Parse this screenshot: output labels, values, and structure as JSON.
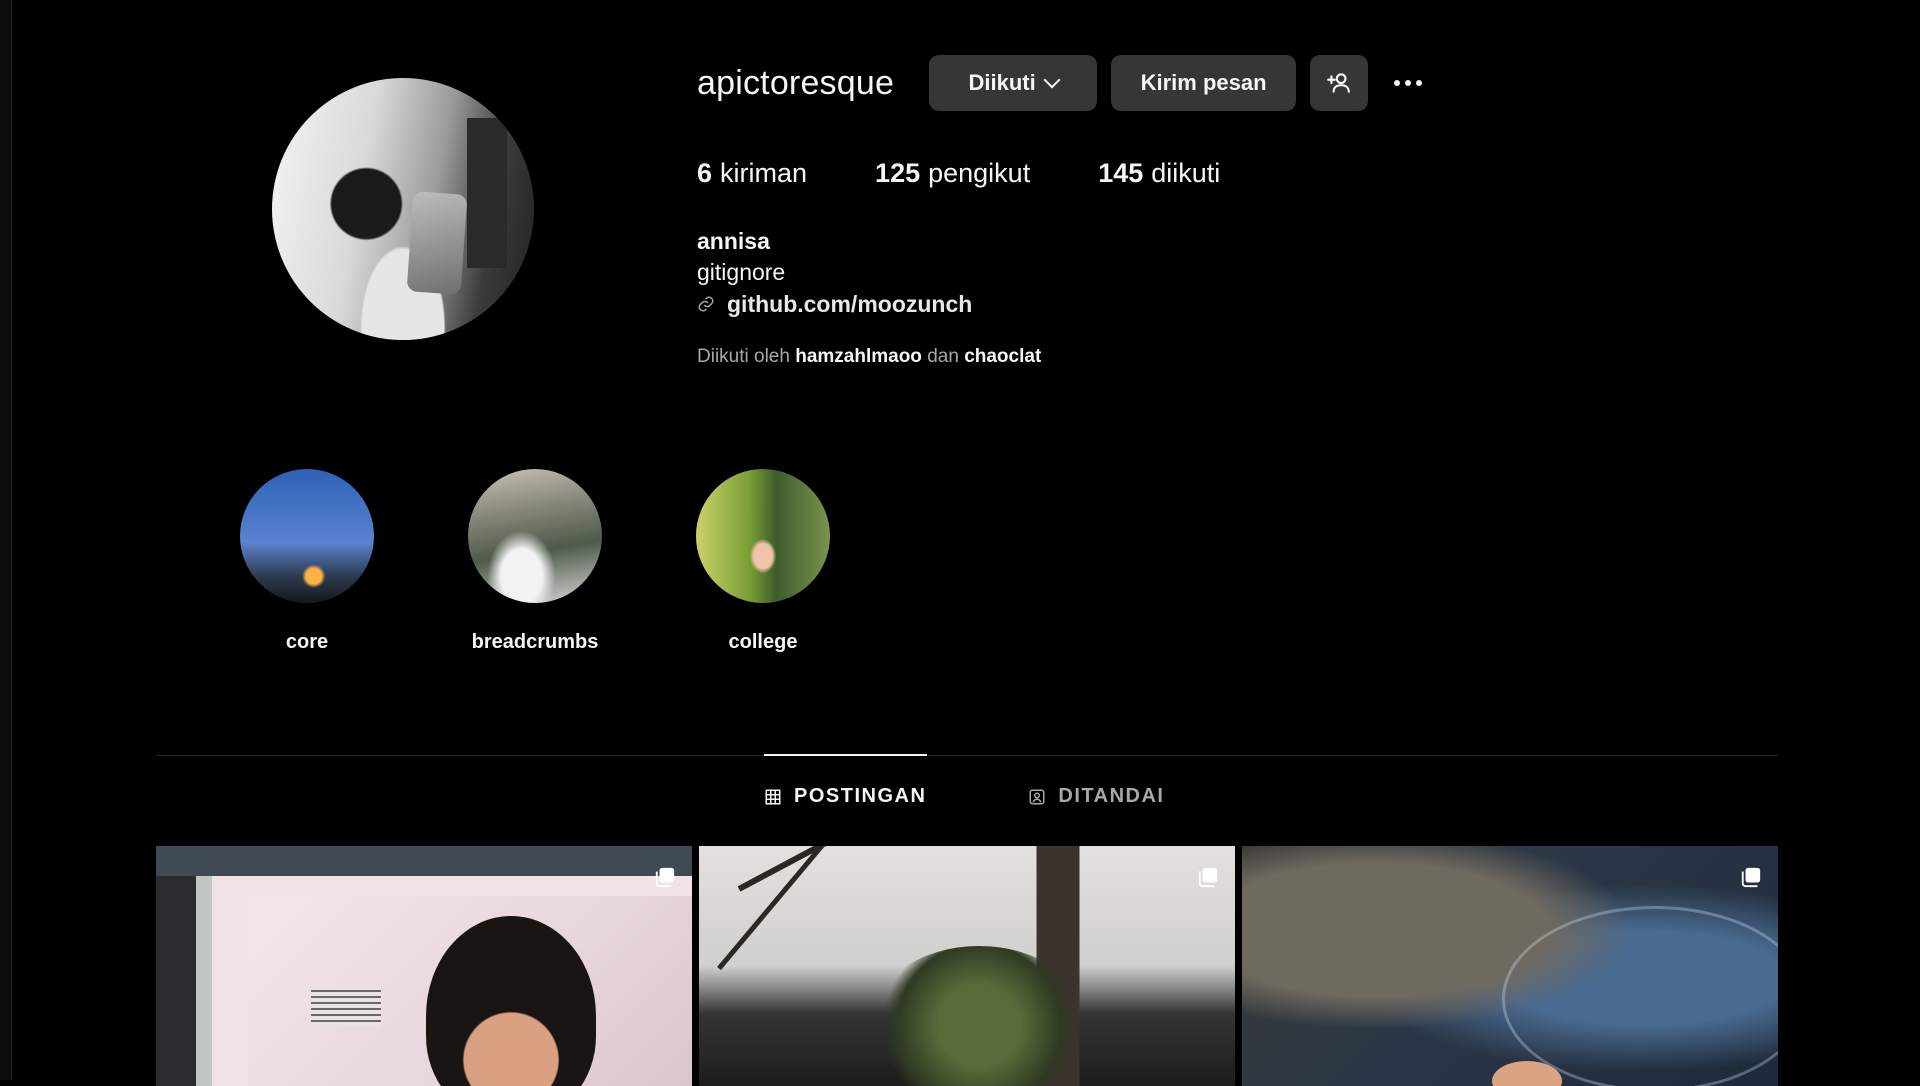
{
  "profile": {
    "username": "apictoresque",
    "follow_button": "Diikuti",
    "message_button": "Kirim pesan",
    "stats": {
      "posts_count": "6",
      "posts_label": "kiriman",
      "followers_count": "125",
      "followers_label": "pengikut",
      "following_count": "145",
      "following_label": "diikuti"
    },
    "bio": {
      "name": "annisa",
      "text": "gitignore",
      "link": "github.com/moozunch"
    },
    "followed_by": {
      "prefix": "Diikuti oleh",
      "user1": "hamzahlmaoo",
      "conjunction": "dan",
      "user2": "chaoclat"
    }
  },
  "highlights": [
    {
      "label": "core"
    },
    {
      "label": "breadcrumbs"
    },
    {
      "label": "college"
    }
  ],
  "tabs": [
    {
      "label": "POSTINGAN",
      "icon": "grid-icon",
      "active": true
    },
    {
      "label": "DITANDAI",
      "icon": "tagged-user-icon",
      "active": false
    }
  ],
  "posts": [
    {
      "icon": "multiple-posts-icon"
    },
    {
      "icon": "multiple-posts-icon"
    },
    {
      "icon": "multiple-posts-icon"
    }
  ],
  "colors": {
    "background": "#000000",
    "button_bg": "#363636",
    "text_primary": "#f5f5f5",
    "text_secondary": "#a8a8a8"
  }
}
